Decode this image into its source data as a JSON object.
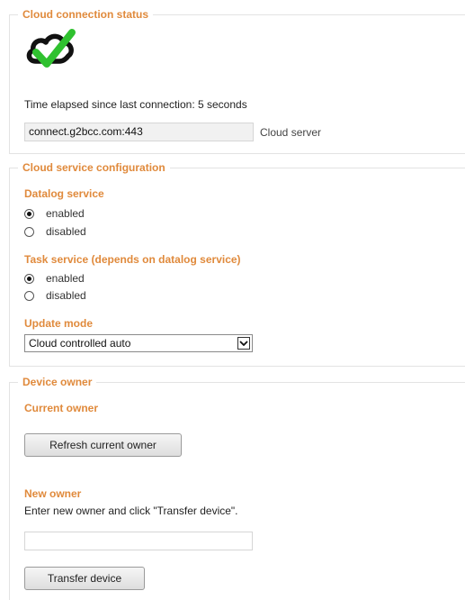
{
  "cloud_status": {
    "legend": "Cloud connection status",
    "icon": "cloud-check-icon",
    "elapsed_text": "Time elapsed since last connection: 5 seconds",
    "server_value": "connect.g2bcc.com:443",
    "server_label": "Cloud server"
  },
  "service_config": {
    "legend": "Cloud service configuration",
    "datalog": {
      "title": "Datalog service",
      "options": [
        "enabled",
        "disabled"
      ],
      "selected": "enabled"
    },
    "task": {
      "title": "Task service (depends on datalog service)",
      "options": [
        "enabled",
        "disabled"
      ],
      "selected": "enabled"
    },
    "update_mode": {
      "title": "Update mode",
      "selected": "Cloud controlled auto"
    }
  },
  "device_owner": {
    "legend": "Device owner",
    "current_owner_title": "Current owner",
    "refresh_button": "Refresh current owner",
    "new_owner_title": "New owner",
    "instructions": "Enter new owner and click \"Transfer device\".",
    "new_owner_value": "",
    "transfer_button": "Transfer device"
  },
  "colors": {
    "accent": "#e08a3c",
    "check_green": "#2fc12f",
    "cloud_black": "#111111"
  }
}
